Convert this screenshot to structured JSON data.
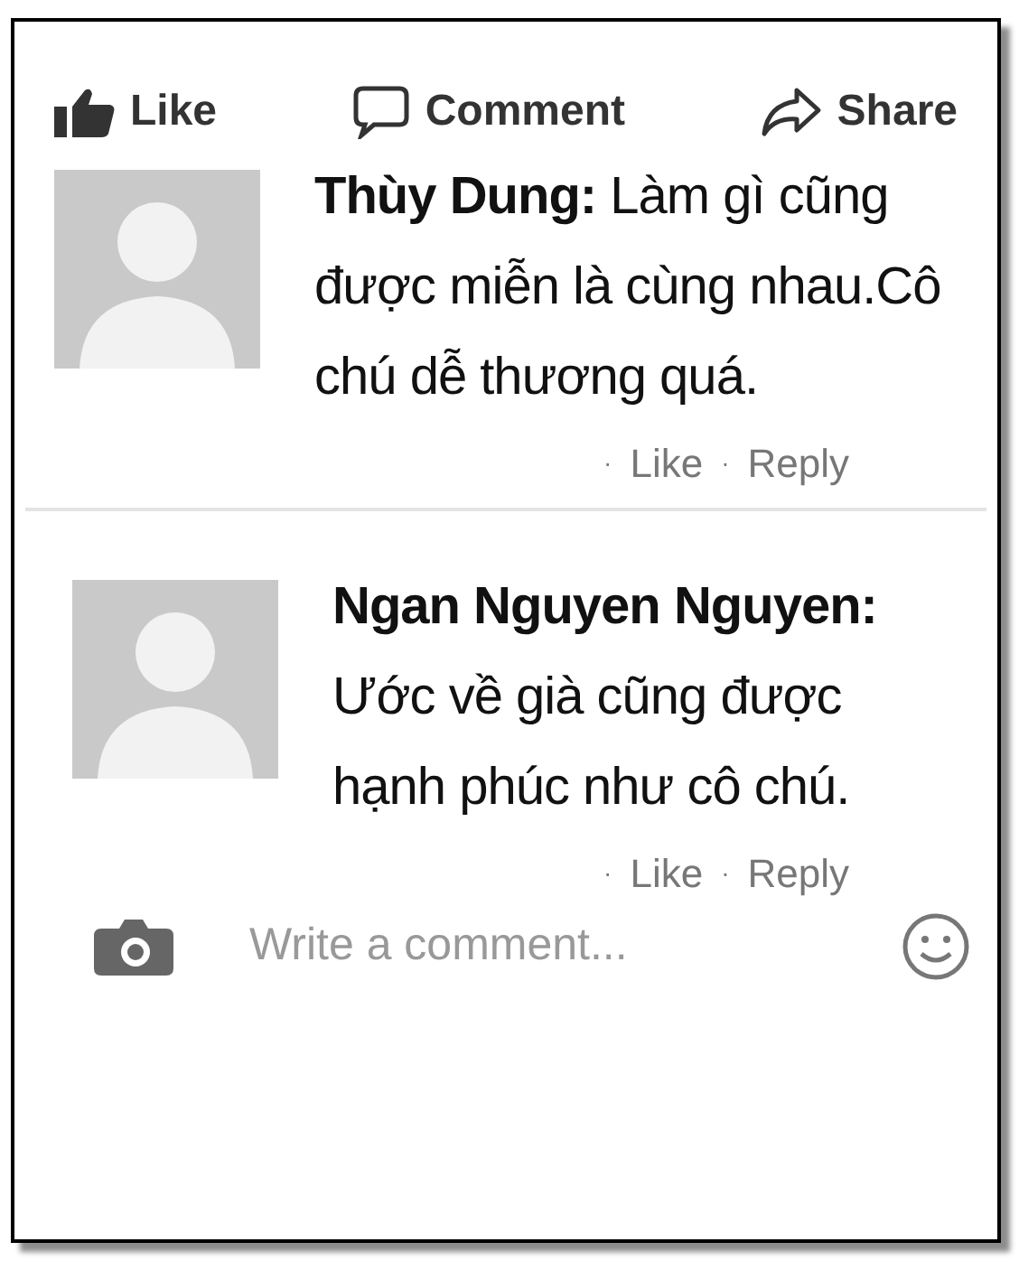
{
  "actions": [
    {
      "kind": "like",
      "label": "Like"
    },
    {
      "kind": "comment",
      "label": "Comment"
    },
    {
      "kind": "share",
      "label": "Share"
    }
  ],
  "comments": [
    {
      "author": "Thùy Dung:",
      "text": "Làm gì cũng được miễn là cùng nhau.Cô chú dễ thương quá.",
      "links": [
        {
          "dot": "·",
          "label": "Like"
        },
        {
          "dot": "·",
          "label": "Reply"
        }
      ]
    },
    {
      "author": "Ngan Nguyen Nguyen:",
      "text": "Ước về già cũng được hạnh phúc như cô chú.",
      "links": [
        {
          "dot": "·",
          "label": "Like"
        },
        {
          "dot": "·",
          "label": "Reply"
        }
      ]
    }
  ],
  "composer": {
    "placeholder": "Write a comment..."
  }
}
